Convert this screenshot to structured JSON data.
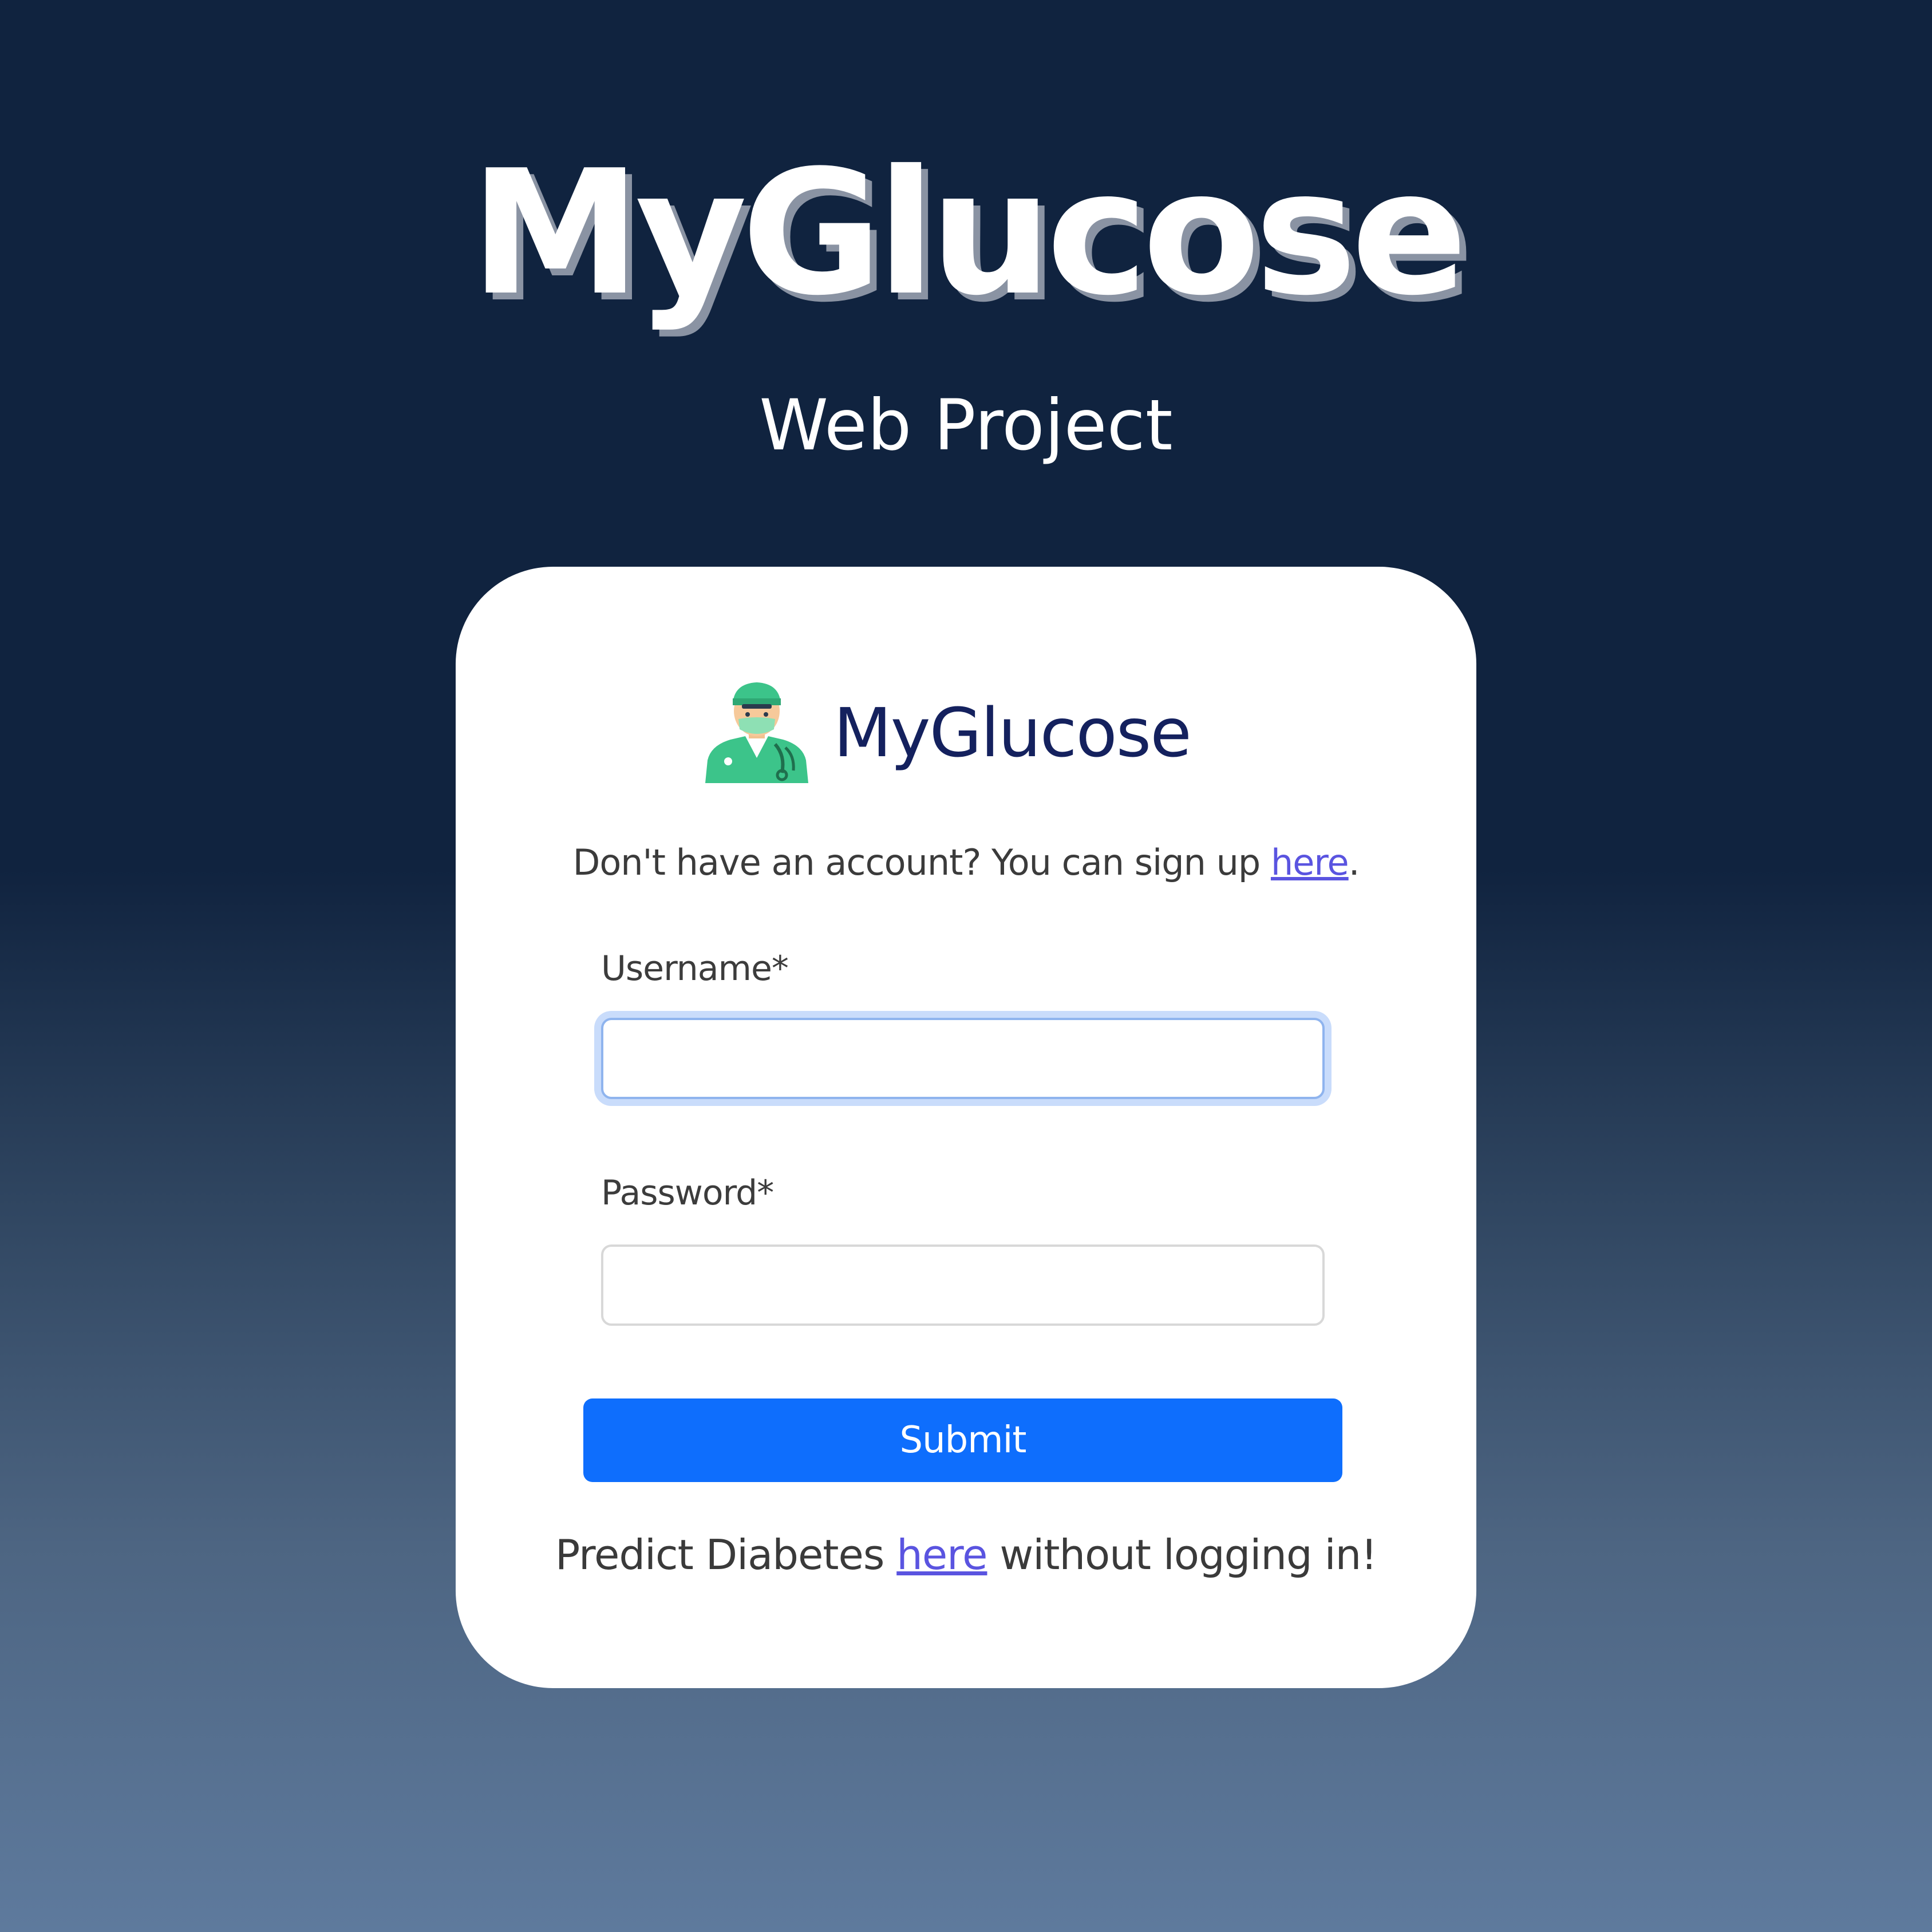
{
  "hero": {
    "title": "MyGlucose",
    "subtitle": "Web Project"
  },
  "card": {
    "brand": {
      "name": "MyGlucose",
      "icon": "doctor-avatar-icon"
    },
    "signup": {
      "text_before": "Don't have an account? You can sign up ",
      "link_label": "here",
      "text_after": "."
    },
    "form": {
      "username_label": "Username*",
      "username_value": "",
      "password_label": "Password*",
      "password_value": "",
      "submit_label": "Submit"
    },
    "predict": {
      "text_before": "Predict Diabetes ",
      "link_label": "here",
      "text_after": " without logging in!"
    }
  },
  "colors": {
    "background_top": "#10233f",
    "background_bottom": "#5e7a9d",
    "brand_text": "#14215e",
    "link": "#5a54e0",
    "submit_button": "#0e6efd",
    "focus_ring": "#c9dcfb"
  }
}
